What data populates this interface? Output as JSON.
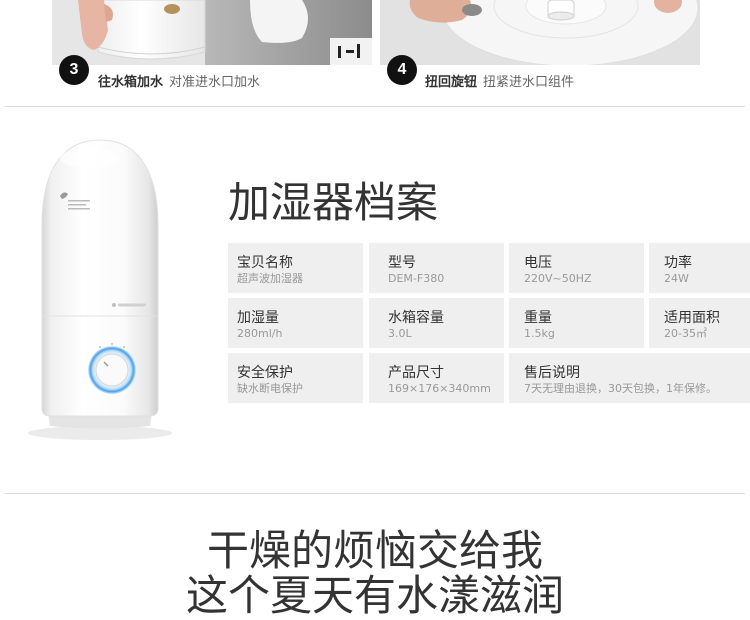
{
  "steps": [
    {
      "number": "3",
      "title": "往水箱加水",
      "desc": "对准进水口加水"
    },
    {
      "number": "4",
      "title": "扭回旋钮",
      "desc": "扭紧进水口组件"
    }
  ],
  "profile": {
    "title": "加湿器档案",
    "rows": [
      [
        {
          "label": "宝贝名称",
          "value": "超声波加湿器"
        },
        {
          "label": "型号",
          "value": "DEM-F380"
        },
        {
          "label": "电压",
          "value": "220V~50HZ"
        },
        {
          "label": "功率",
          "value": "24W"
        }
      ],
      [
        {
          "label": "加湿量",
          "value": "280ml/h"
        },
        {
          "label": "水箱容量",
          "value": "3.0L"
        },
        {
          "label": "重量",
          "value": "1.5kg"
        },
        {
          "label": "适用面积",
          "value": "20-35㎡"
        }
      ],
      [
        {
          "label": "安全保护",
          "value": "缺水断电保护"
        },
        {
          "label": "产品尺寸",
          "value": "169×176×340mm"
        },
        {
          "label": "售后说明",
          "value": "7天无理由退换，30天包换，1年保修。"
        }
      ]
    ]
  },
  "slogan": {
    "line1": "干燥的烦恼交给我",
    "line2": "这个夏天有水漾滋润"
  },
  "colors": {
    "badge": "#111111",
    "cell_bg": "#efefef",
    "knob_glow": "#4a9fe8"
  }
}
